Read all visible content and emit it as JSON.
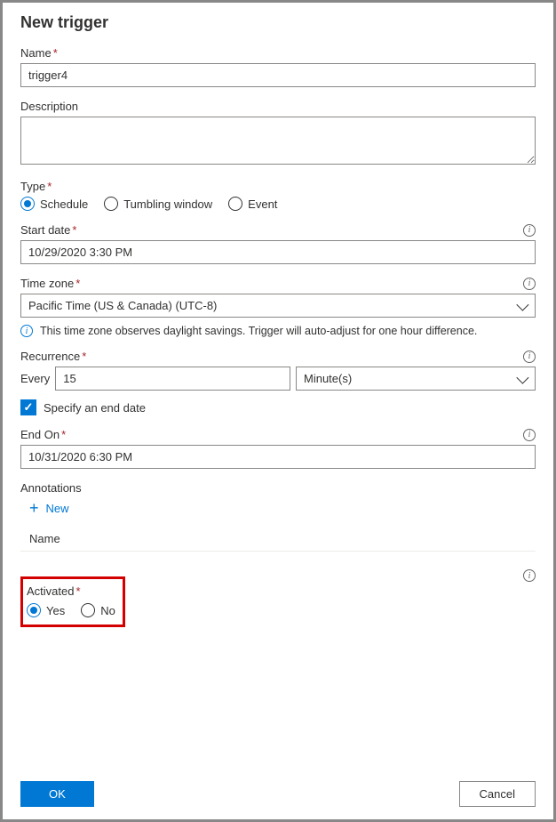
{
  "title": "New trigger",
  "fields": {
    "name": {
      "label": "Name",
      "value": "trigger4"
    },
    "description": {
      "label": "Description",
      "value": ""
    },
    "type": {
      "label": "Type",
      "options": [
        "Schedule",
        "Tumbling window",
        "Event"
      ],
      "selected": "Schedule"
    },
    "start_date": {
      "label": "Start date",
      "value": "10/29/2020 3:30 PM"
    },
    "time_zone": {
      "label": "Time zone",
      "value": "Pacific Time (US & Canada) (UTC-8)"
    },
    "tz_note": "This time zone observes daylight savings. Trigger will auto-adjust for one hour difference.",
    "recurrence": {
      "label": "Recurrence",
      "prefix": "Every",
      "value": "15",
      "unit": "Minute(s)"
    },
    "specify_end": {
      "label": "Specify an end date",
      "checked": true
    },
    "end_on": {
      "label": "End On",
      "value": "10/31/2020 6:30 PM"
    },
    "annotations": {
      "label": "Annotations",
      "new_label": "New",
      "col_name": "Name"
    },
    "activated": {
      "label": "Activated",
      "options": [
        "Yes",
        "No"
      ],
      "selected": "Yes"
    }
  },
  "buttons": {
    "ok": "OK",
    "cancel": "Cancel"
  }
}
